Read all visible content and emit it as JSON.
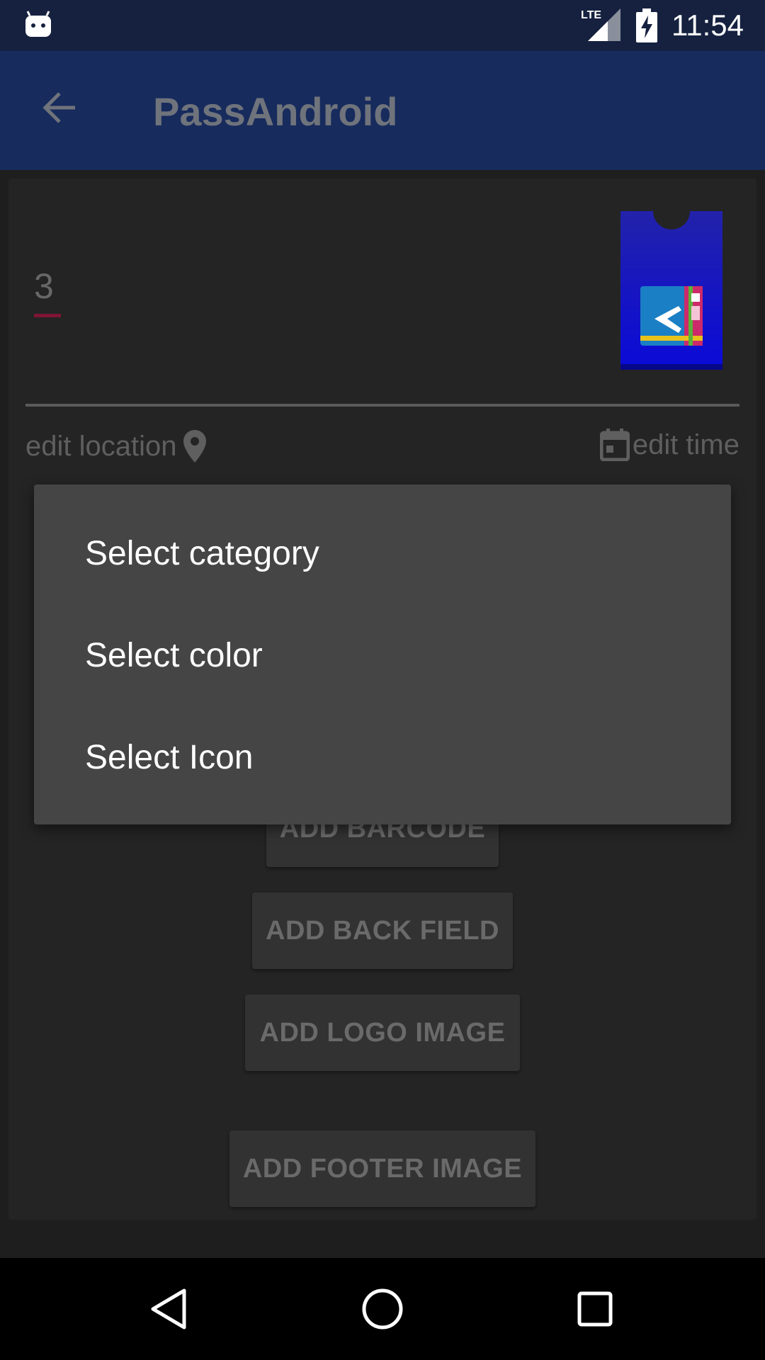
{
  "status_bar": {
    "time": "11:54",
    "network_label": "LTE",
    "icons": [
      "android-icon",
      "lte-signal-icon",
      "battery-charging-icon"
    ]
  },
  "app_bar": {
    "title": "PassAndroid",
    "back_icon": "arrow-back-icon"
  },
  "pass": {
    "number": "3",
    "accent_color": "#7e1535",
    "image_icon": "pass-ticket-image"
  },
  "meta": {
    "edit_location": "edit location",
    "edit_time": "edit time",
    "location_icon": "location-pin-icon",
    "calendar_icon": "calendar-icon"
  },
  "buttons": {
    "add_barcode": "ADD BARCODE",
    "add_back_field": "ADD BACK FIELD",
    "add_logo_image": "ADD LOGO IMAGE",
    "add_footer_image": "ADD FOOTER IMAGE"
  },
  "dialog": {
    "items": [
      {
        "label": "Select category"
      },
      {
        "label": "Select color"
      },
      {
        "label": "Select Icon"
      }
    ]
  },
  "nav_bar": {
    "icons": [
      "nav-back-icon",
      "nav-home-icon",
      "nav-recents-icon"
    ]
  },
  "colors": {
    "status_bar": "#15213f",
    "app_bar": "#172b5d",
    "dialog": "#454545",
    "background": "#1e1e1e"
  }
}
